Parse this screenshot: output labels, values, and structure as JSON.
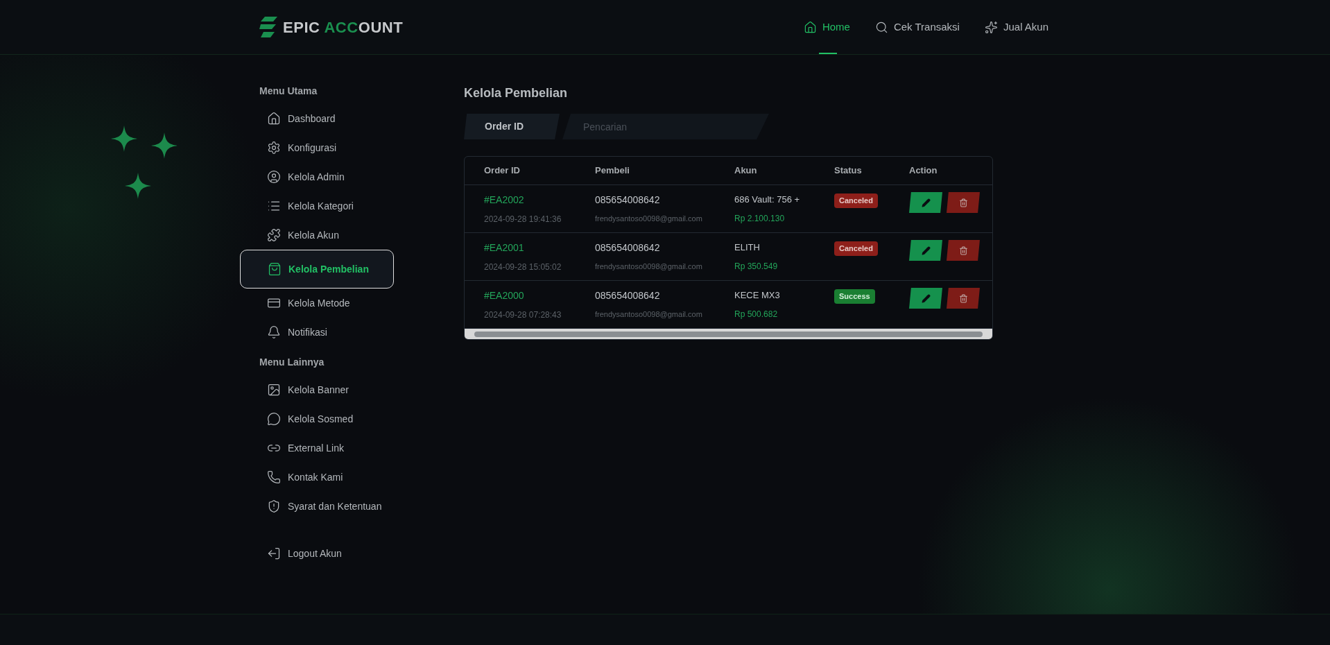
{
  "header": {
    "logo": {
      "part_1": "EPIC ",
      "part_2": "ACC",
      "part_3": "OUNT"
    },
    "nav": [
      {
        "label": "Home",
        "selected": true
      },
      {
        "label": "Cek Transaksi",
        "selected": false
      },
      {
        "label": "Jual Akun",
        "selected": false
      }
    ]
  },
  "sidebar": {
    "sections": [
      {
        "title": "Menu Utama",
        "items": [
          {
            "label": "Dashboard",
            "selected": false
          },
          {
            "label": "Konfigurasi",
            "selected": false
          },
          {
            "label": "Kelola Admin",
            "selected": false
          },
          {
            "label": "Kelola Kategori",
            "selected": false
          },
          {
            "label": "Kelola Akun",
            "selected": false
          },
          {
            "label": "Kelola Pembelian",
            "selected": true
          },
          {
            "label": "Kelola Metode",
            "selected": false
          },
          {
            "label": "Notifikasi",
            "selected": false
          }
        ]
      },
      {
        "title": "Menu Lainnya",
        "items": [
          {
            "label": "Kelola Banner",
            "selected": false
          },
          {
            "label": "Kelola Sosmed",
            "selected": false
          },
          {
            "label": "External Link",
            "selected": false
          },
          {
            "label": "Kontak Kami",
            "selected": false
          },
          {
            "label": "Syarat dan Ketentuan",
            "selected": false
          }
        ]
      }
    ],
    "logout": {
      "label": "Logout Akun"
    }
  },
  "main": {
    "title": "Kelola Pembelian",
    "filter": {
      "selector": "Order ID",
      "placeholder": "Pencarian"
    },
    "table": {
      "columns": [
        "Order ID",
        "Pembeli",
        "Akun",
        "Status",
        "Action"
      ],
      "rows": [
        {
          "order_id": "#EA2002",
          "date": "2024-09-28 19:41:36",
          "phone": "085654008642",
          "email": "frendysantoso0098@gmail.com",
          "account": "686 Vault: 756 +",
          "price": "Rp 2.100.130",
          "status": {
            "text": "Canceled",
            "kind": "canceled"
          }
        },
        {
          "order_id": "#EA2001",
          "date": "2024-09-28 15:05:02",
          "phone": "085654008642",
          "email": "frendysantoso0098@gmail.com",
          "account": "ELITH",
          "price": "Rp 350.549",
          "status": {
            "text": "Canceled",
            "kind": "canceled"
          }
        },
        {
          "order_id": "#EA2000",
          "date": "2024-09-28 07:28:43",
          "phone": "085654008642",
          "email": "frendysantoso0098@gmail.com",
          "account": "KECE MX3",
          "price": "Rp 500.682",
          "status": {
            "text": "Success",
            "kind": "success"
          }
        }
      ]
    }
  }
}
